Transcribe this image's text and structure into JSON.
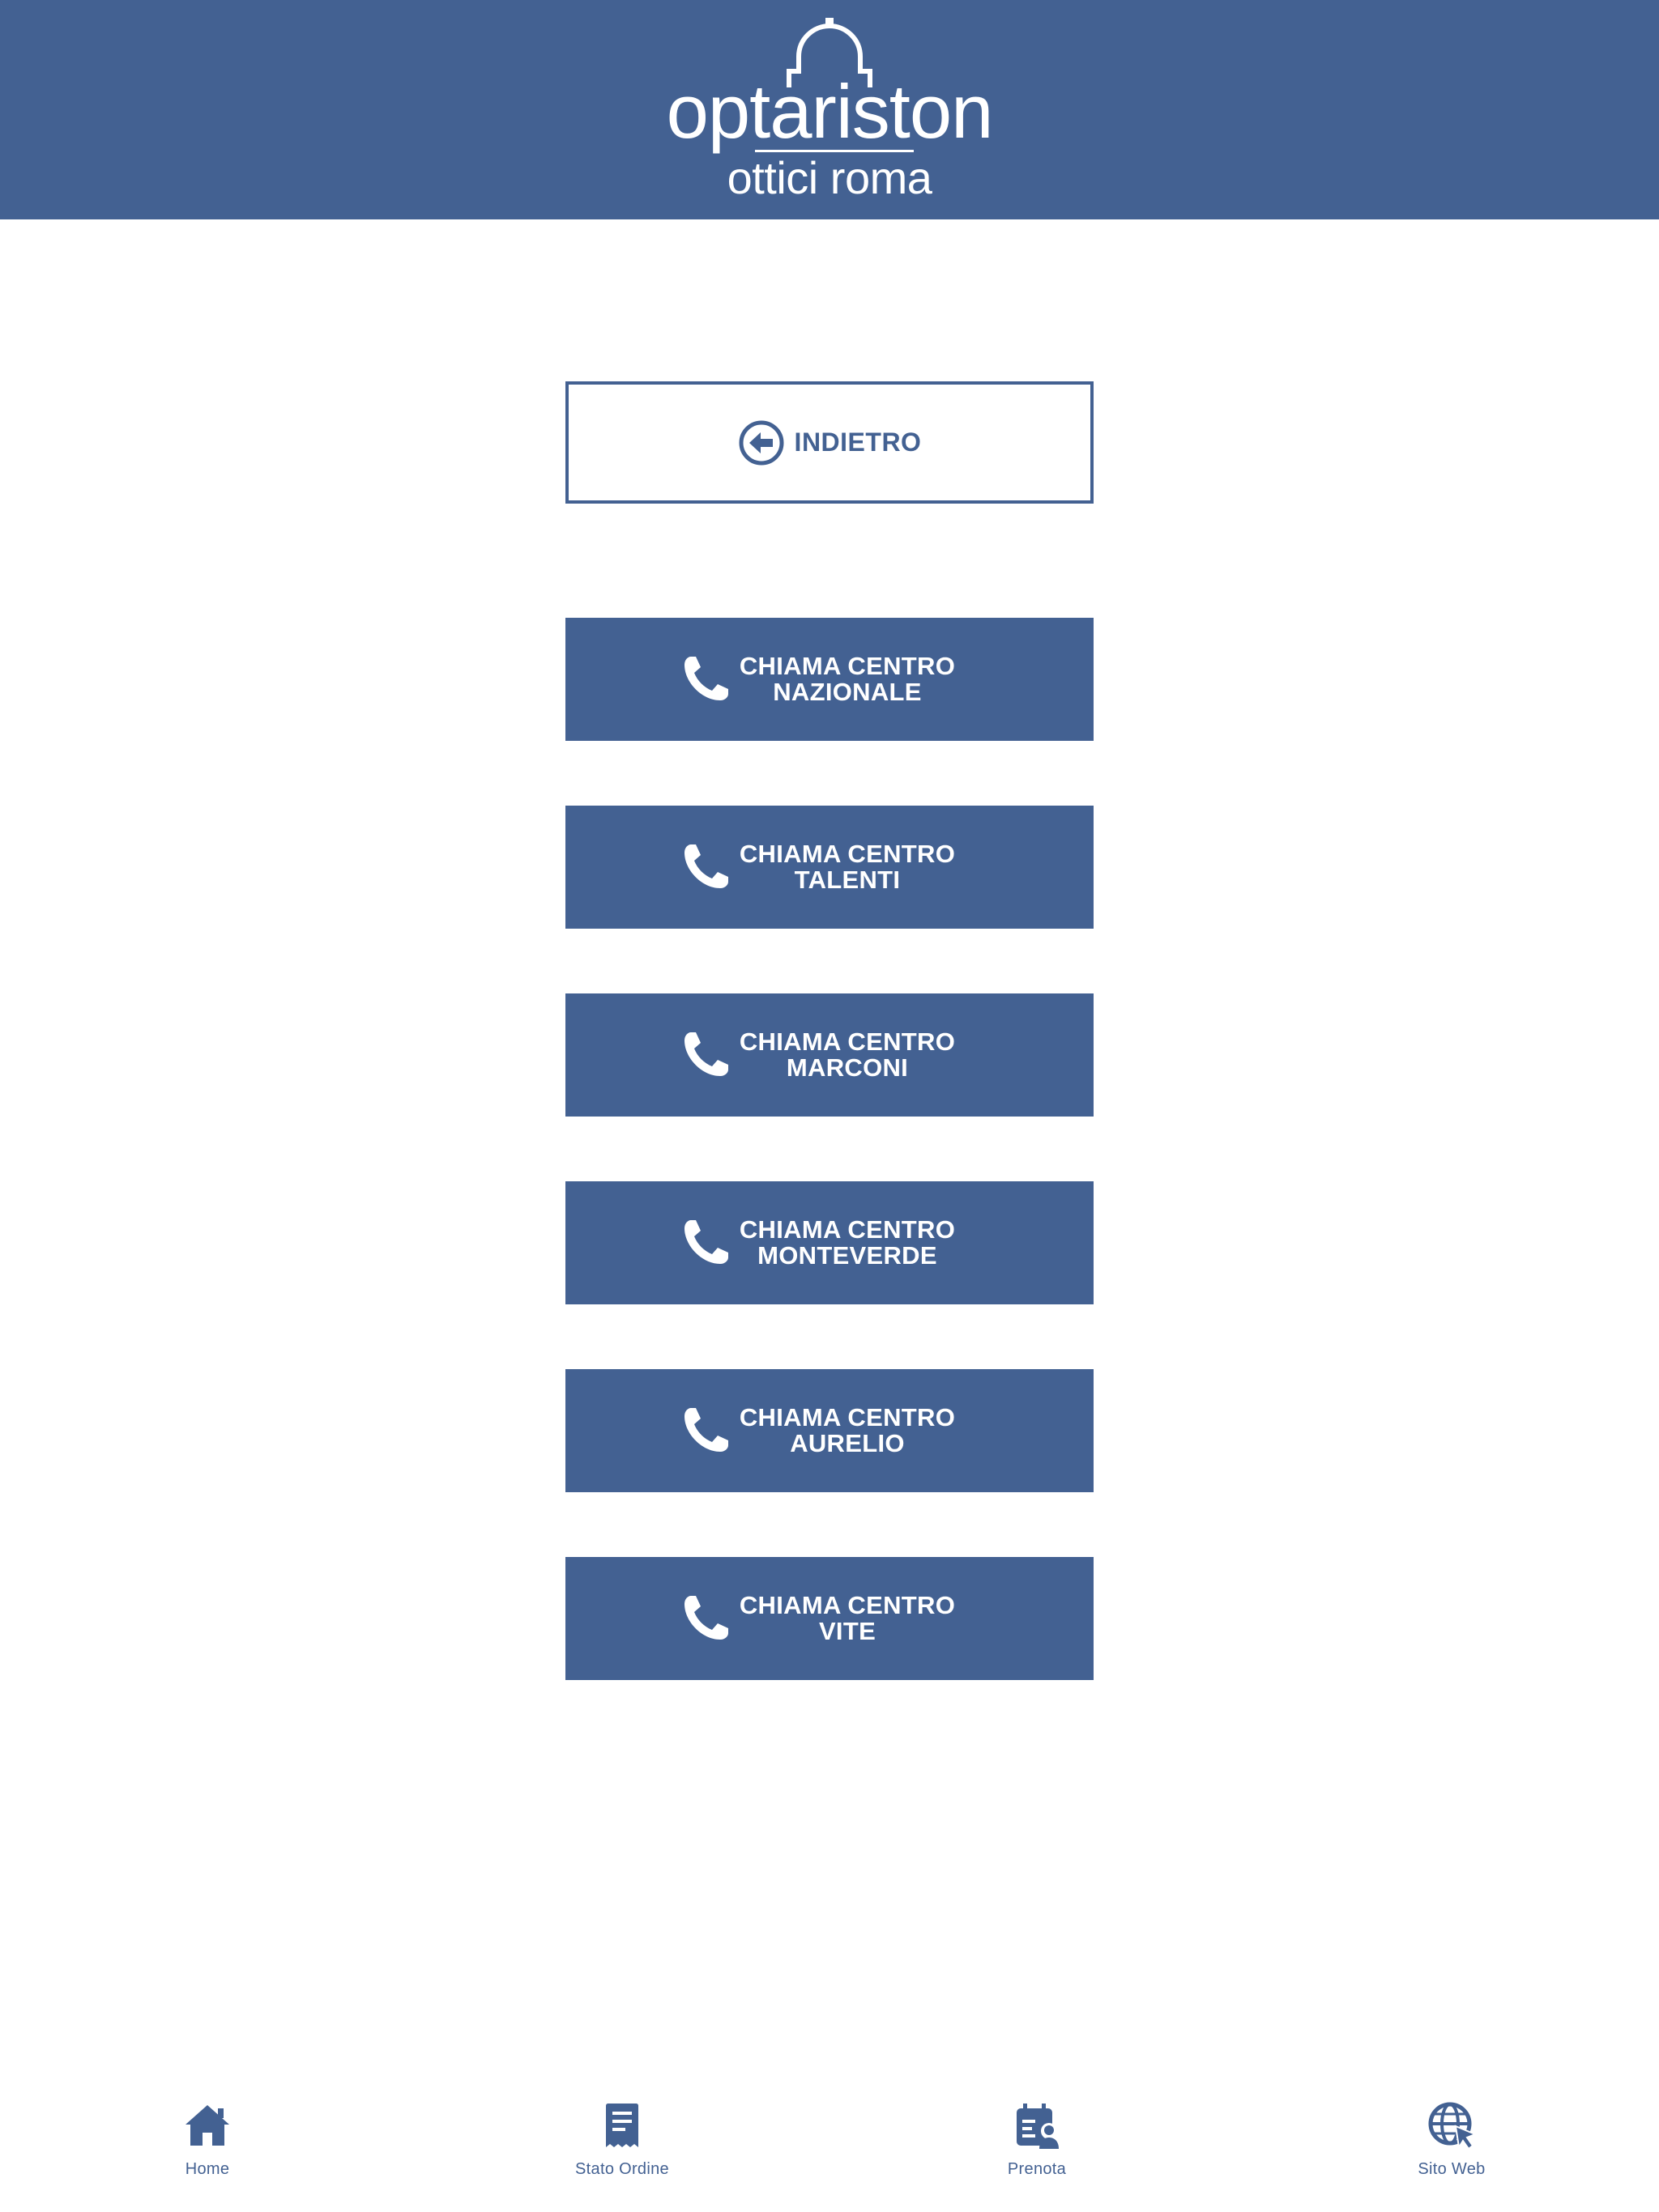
{
  "brand": {
    "name": "optariston",
    "tagline": "ottici roma",
    "color": "#436192"
  },
  "back_button": {
    "label": "INDIETRO",
    "icon": "arrow-left-circle-icon"
  },
  "call_buttons": [
    {
      "line1": "CHIAMA CENTRO",
      "line2": "NAZIONALE",
      "icon": "phone-icon"
    },
    {
      "line1": "CHIAMA CENTRO",
      "line2": "TALENTI",
      "icon": "phone-icon"
    },
    {
      "line1": "CHIAMA CENTRO",
      "line2": "MARCONI",
      "icon": "phone-icon"
    },
    {
      "line1": "CHIAMA CENTRO",
      "line2": "MONTEVERDE",
      "icon": "phone-icon"
    },
    {
      "line1": "CHIAMA CENTRO",
      "line2": "AURELIO",
      "icon": "phone-icon"
    },
    {
      "line1": "CHIAMA CENTRO",
      "line2": "VITE",
      "icon": "phone-icon"
    }
  ],
  "tabbar": {
    "items": [
      {
        "label": "Home",
        "icon": "home-icon"
      },
      {
        "label": "Stato Ordine",
        "icon": "receipt-icon"
      },
      {
        "label": "Prenota",
        "icon": "calendar-user-icon"
      },
      {
        "label": "Sito Web",
        "icon": "globe-cursor-icon"
      }
    ]
  }
}
